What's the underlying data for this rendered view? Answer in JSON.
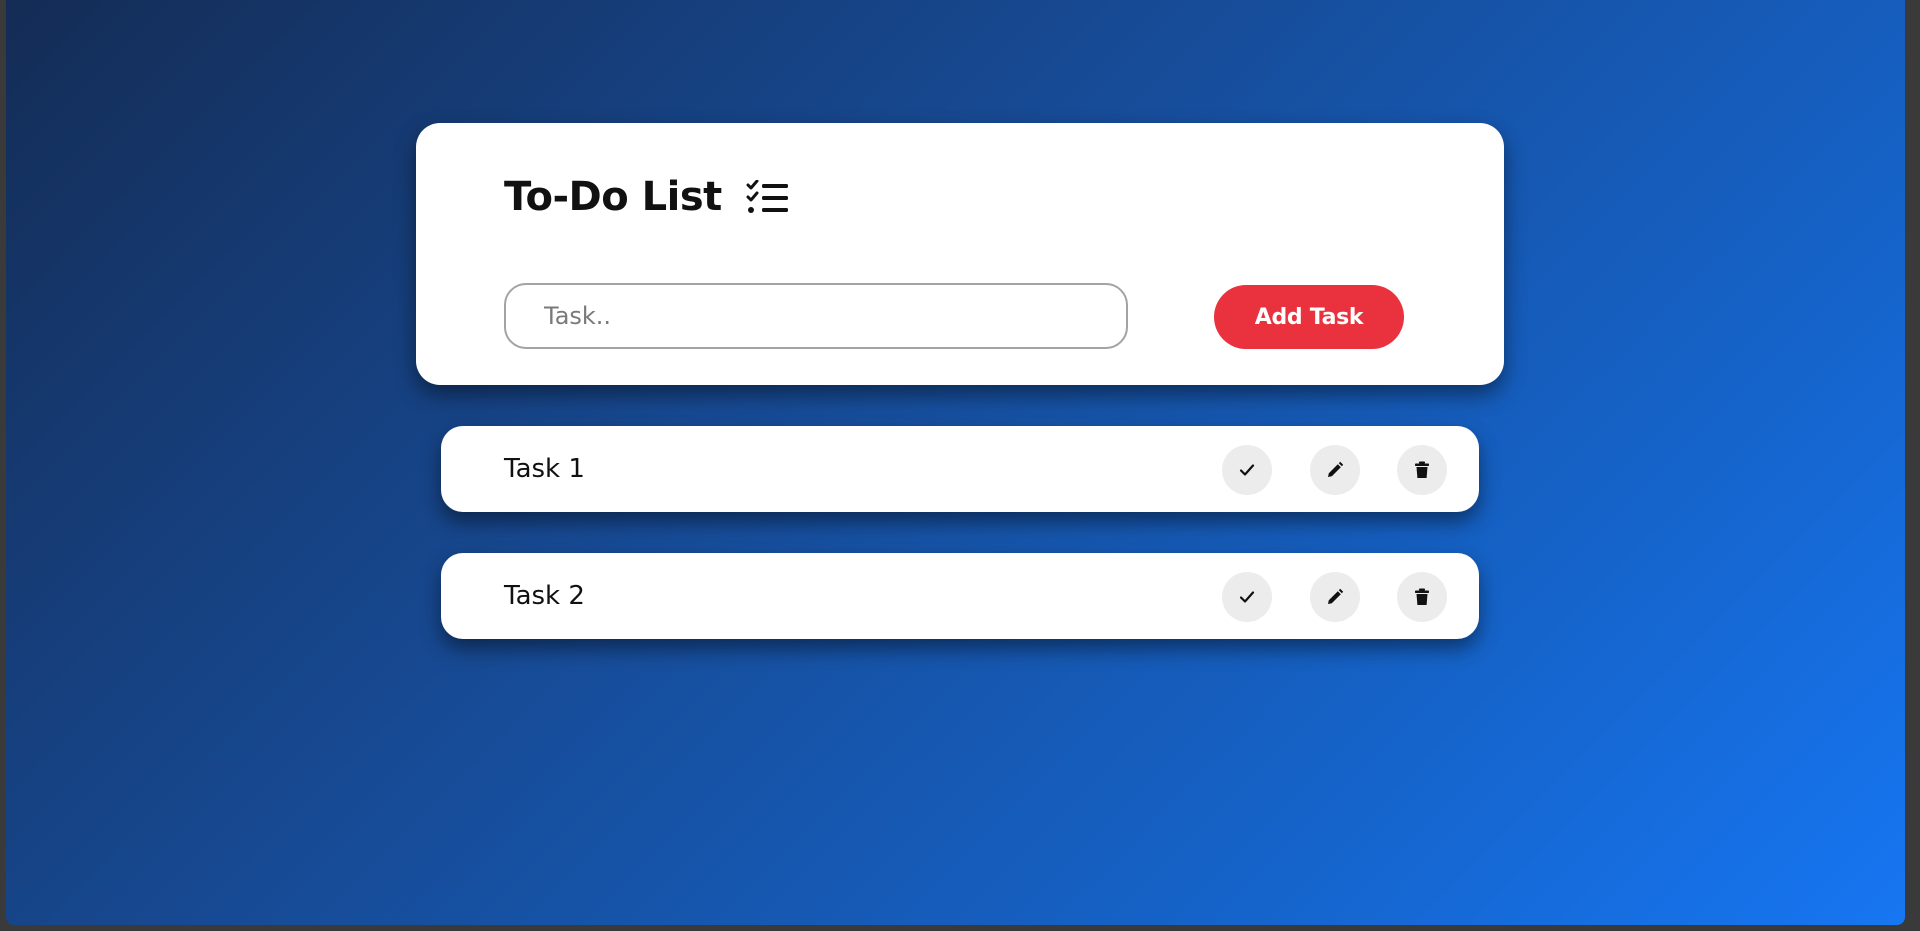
{
  "app": {
    "title": "To-Do List",
    "title_icon": "checklist-icon"
  },
  "form": {
    "input_value": "",
    "input_placeholder": "Task..",
    "add_button_label": "Add Task"
  },
  "tasks": [
    {
      "label": "Task 1",
      "actions": [
        "check-icon",
        "pencil-icon",
        "trash-icon"
      ]
    },
    {
      "label": "Task 2",
      "actions": [
        "check-icon",
        "pencil-icon",
        "trash-icon"
      ]
    }
  ],
  "colors": {
    "background_start": "#142c55",
    "background_end": "#1776f2",
    "accent": "#e9323e",
    "card": "#ffffff",
    "icon_button": "#ececec"
  }
}
